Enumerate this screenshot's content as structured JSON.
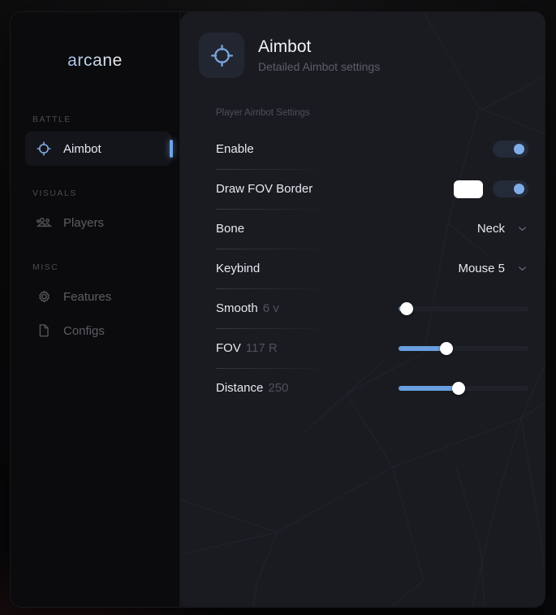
{
  "app": {
    "brand": "arcane"
  },
  "sidebar": {
    "sections": [
      {
        "label": "BATTLE",
        "items": [
          {
            "label": "Aimbot",
            "icon": "crosshair-icon",
            "active": true
          }
        ]
      },
      {
        "label": "VISUALS",
        "items": [
          {
            "label": "Players",
            "icon": "people-icon",
            "active": false
          }
        ]
      },
      {
        "label": "MISC",
        "items": [
          {
            "label": "Features",
            "icon": "gear-icon",
            "active": false
          },
          {
            "label": "Configs",
            "icon": "document-icon",
            "active": false
          }
        ]
      }
    ]
  },
  "header": {
    "icon": "crosshair-icon",
    "title": "Aimbot",
    "subtitle": "Detailed Aimbot settings"
  },
  "main": {
    "section_label": "Player Aimbot Settings",
    "rows": [
      {
        "label": "Enable",
        "control": "toggle",
        "toggle_on": true
      },
      {
        "label": "Draw FOV Border",
        "control": "color-toggle",
        "color": "#ffffff",
        "toggle_on": true
      },
      {
        "label": "Bone",
        "control": "dropdown",
        "value": "Neck"
      },
      {
        "label": "Keybind",
        "control": "dropdown",
        "value": "Mouse 5"
      },
      {
        "label": "Smooth",
        "control": "slider",
        "value": "6 v",
        "percent": 6
      },
      {
        "label": "FOV",
        "control": "slider",
        "value": "117 R",
        "percent": 37
      },
      {
        "label": "Distance",
        "control": "slider",
        "value": "250",
        "percent": 46
      }
    ]
  },
  "colors": {
    "accent": "#6fa3e4",
    "toggle_knob": "#7fadea",
    "slider_fill": "#6a9ee0",
    "panel": "#1a1b20",
    "sidebar": "#0b0b0d"
  }
}
